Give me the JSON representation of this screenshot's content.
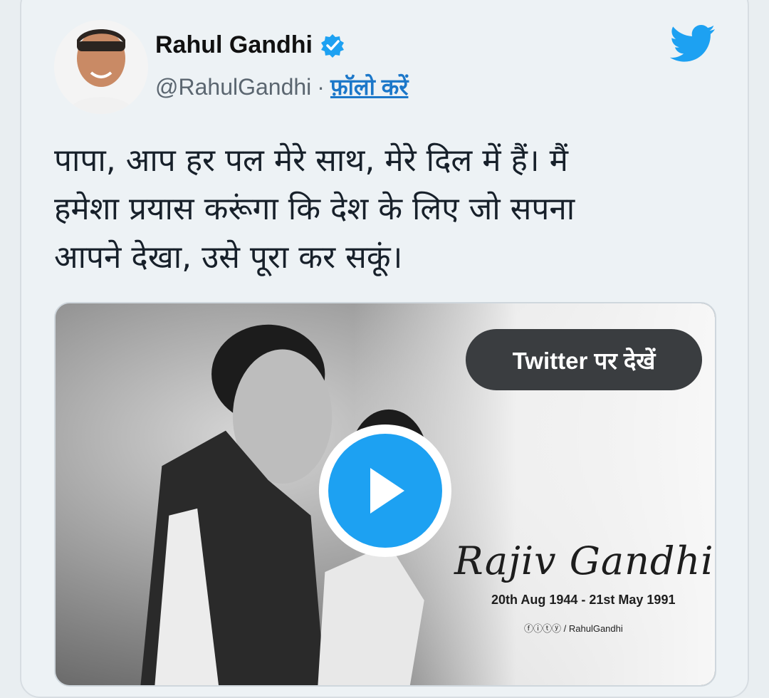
{
  "header": {
    "name": "Rahul Gandhi",
    "handle": "@RahulGandhi",
    "separator": "·",
    "follow_label": "फ़ॉलो करें",
    "accent": "#1da1f2"
  },
  "tweet": {
    "lines": [
      "पापा, आप हर पल मेरे साथ, मेरे दिल में हैं। मैं",
      "हमेशा प्रयास करूंगा कि देश के लिए जो सपना",
      "आपने देखा, उसे पूरा कर सकूं।"
    ]
  },
  "media": {
    "view_label": "Twitter पर देखें",
    "signature": "Rajiv Gandhi",
    "dates": "20th Aug 1944 - 21st May 1991",
    "social_handle": "/ RahulGandhi"
  },
  "icons": {
    "verified": "verified-badge-icon",
    "twitter": "twitter-bird-icon",
    "play": "play-icon"
  }
}
